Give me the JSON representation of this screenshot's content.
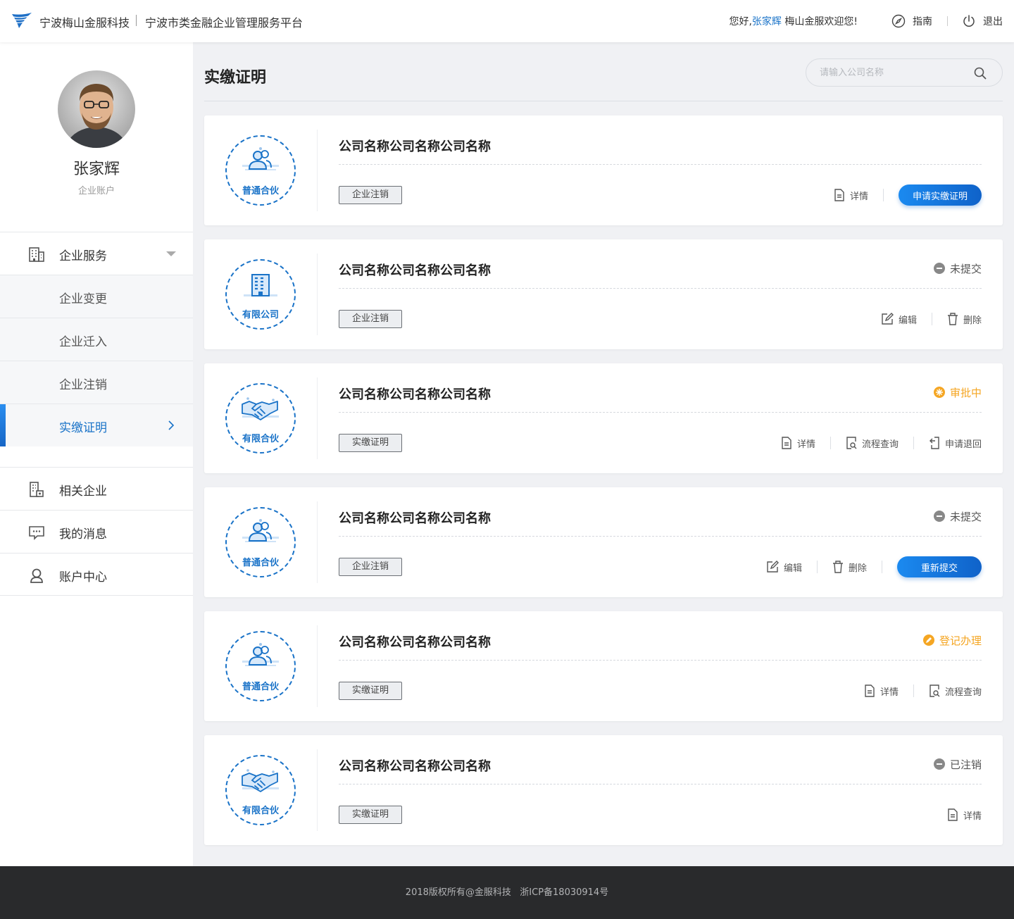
{
  "header": {
    "brand_name": "宁波梅山金服科技",
    "platform_name": "宁波市类金融企业管理服务平台",
    "welcome_prefix": "您好,",
    "username": "张家辉",
    "welcome_suffix": "梅山金服欢迎您!",
    "guide_label": "指南",
    "logout_label": "退出"
  },
  "sidebar": {
    "user_name": "张家辉",
    "user_role": "企业账户",
    "menu": {
      "enterprise_services": "企业服务",
      "items": [
        "企业变更",
        "企业迁入",
        "企业注销",
        "实缴证明"
      ],
      "active_item": "实缴证明",
      "related_companies": "相关企业",
      "my_messages": "我的消息",
      "account_center": "账户中心"
    }
  },
  "main": {
    "title": "实缴证明",
    "search": {
      "placeholder": "请输入公司名称",
      "value": ""
    },
    "cards": [
      {
        "type_label": "普通合伙",
        "company": "公司名称公司名称公司名称",
        "tag": "企业注销",
        "status": "",
        "actions": [
          "详情"
        ],
        "button": "申请实缴证明"
      },
      {
        "type_label": "有限公司",
        "company": "公司名称公司名称公司名称",
        "tag": "企业注销",
        "status": "未提交",
        "actions": [
          "编辑",
          "删除"
        ],
        "button": ""
      },
      {
        "type_label": "有限合伙",
        "company": "公司名称公司名称公司名称",
        "tag": "实缴证明",
        "status": "审批中",
        "actions": [
          "详情",
          "流程查询",
          "申请退回"
        ],
        "button": ""
      },
      {
        "type_label": "普通合伙",
        "company": "公司名称公司名称公司名称",
        "tag": "企业注销",
        "status": "未提交",
        "actions": [
          "编辑",
          "删除"
        ],
        "button": "重新提交"
      },
      {
        "type_label": "普通合伙",
        "company": "公司名称公司名称公司名称",
        "tag": "实缴证明",
        "status": "登记办理",
        "actions": [
          "详情",
          "流程查询"
        ],
        "button": ""
      },
      {
        "type_label": "有限合伙",
        "company": "公司名称公司名称公司名称",
        "tag": "实缴证明",
        "status": "已注销",
        "actions": [
          "详情"
        ],
        "button": ""
      }
    ]
  },
  "footer": {
    "text": "2018版权所有@金服科技   浙ICP备18030914号"
  },
  "colors": {
    "primary": "#1a73c8",
    "warning": "#f5a623",
    "muted": "#888888",
    "footer_bg": "#292a2c"
  },
  "icons": [
    "brand-logo-icon",
    "compass-icon",
    "power-icon",
    "building-icon",
    "office-icon",
    "message-icon",
    "user-icon",
    "search-icon",
    "document-icon",
    "edit-icon",
    "trash-icon",
    "process-search-icon",
    "return-icon",
    "partnership-icon",
    "company-icon",
    "handshake-icon"
  ]
}
